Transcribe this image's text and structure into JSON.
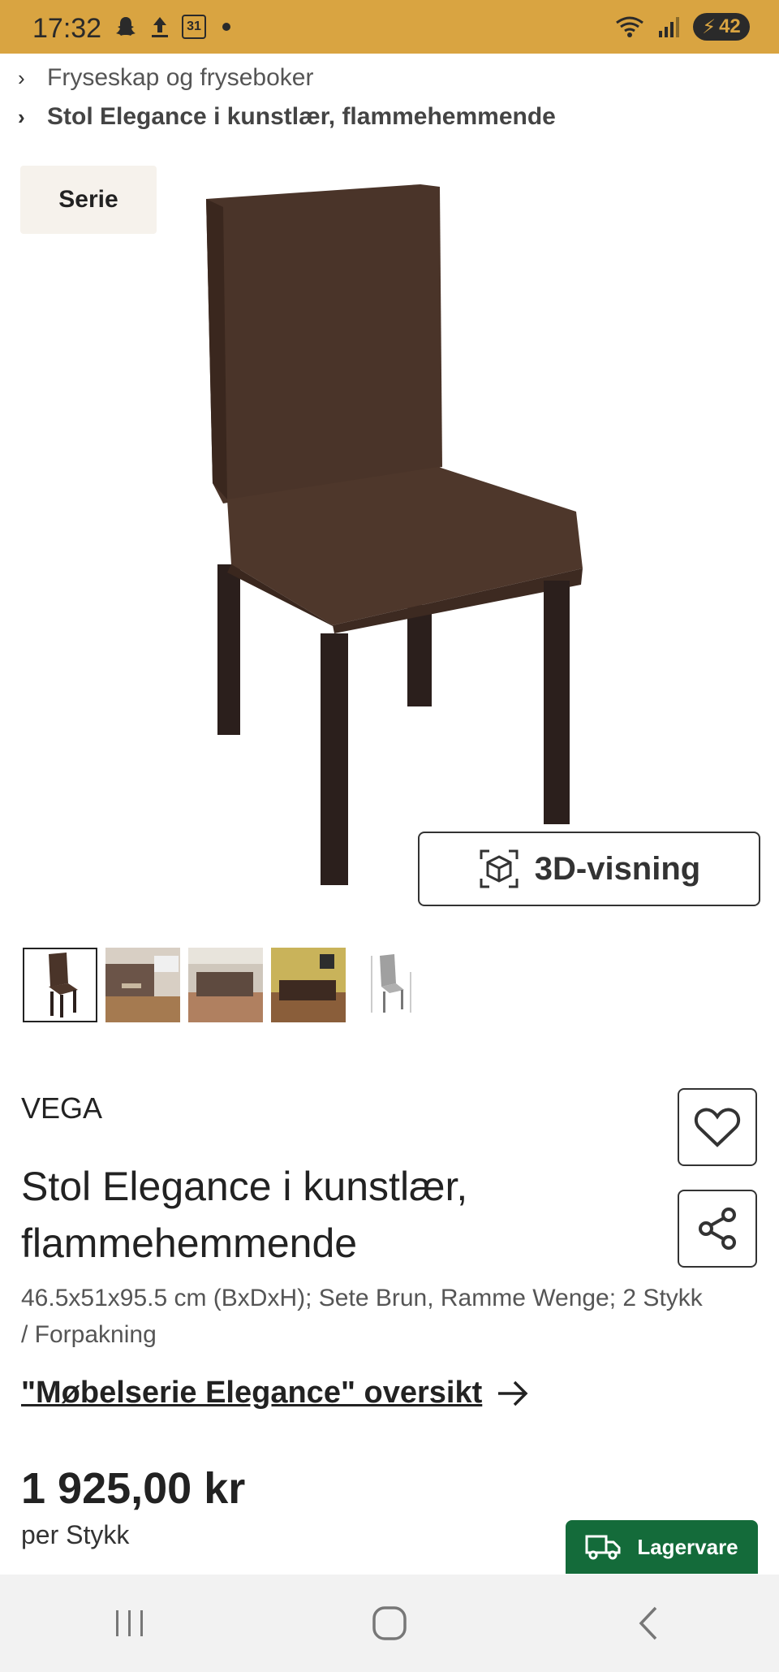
{
  "status_bar": {
    "time": "17:32",
    "calendar_day": "31",
    "battery": "42",
    "background": "#d9a441"
  },
  "breadcrumb": {
    "items": [
      {
        "label": "Fryseskap og fryseboker"
      },
      {
        "label": "Stol Elegance i kunstlær, flammehemmende"
      }
    ]
  },
  "gallery": {
    "tag": "Serie",
    "view_3d_label": "3D-visning",
    "thumbnails": [
      "chair-front",
      "restaurant-booths",
      "dining-room",
      "yellow-wall-dining",
      "dimension-drawing"
    ]
  },
  "product": {
    "brand": "VEGA",
    "title": "Stol Elegance i kunstlær, flammehemmende",
    "specs": "46.5x51x95.5 cm (BxDxH); Sete Brun, Ramme Wenge; 2 Stykk / Forpakning",
    "series_link": "\"Møbelserie Elegance\" oversikt",
    "price": "1 925,00 kr",
    "unit": "per Stykk",
    "stock_label": "Lagervare",
    "stock_color": "#146b3a"
  },
  "icons": {
    "favorite": "heart-icon",
    "share": "share-icon",
    "view_3d": "cube-icon",
    "arrow": "arrow-right-icon",
    "delivery": "truck-icon"
  }
}
